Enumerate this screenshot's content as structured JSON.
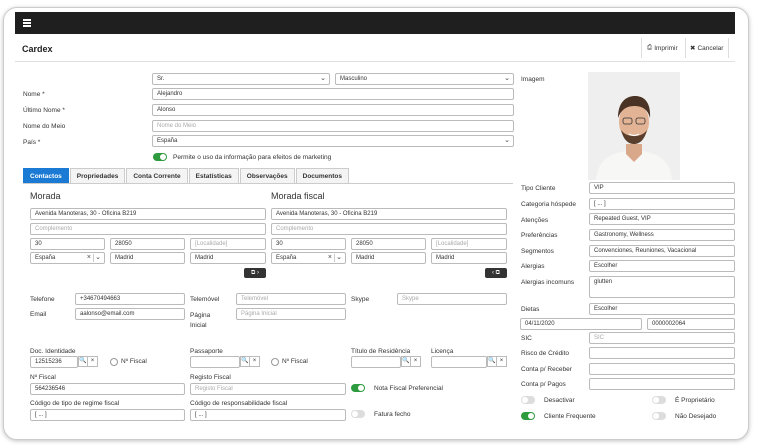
{
  "window": {
    "title": "Cardex",
    "print_label": "Imprimir",
    "cancel_label": "Cancelar"
  },
  "person": {
    "salutation": "Sr.",
    "gender": "Masculino",
    "name_label": "Nome *",
    "name": "Alejandro",
    "last_name_label": "Último Nome *",
    "last_name": "Alonso",
    "middle_name_label": "Nome do Meio",
    "middle_name_placeholder": "Nome do Meio",
    "country_label": "País *",
    "country": "España",
    "marketing_consent": "Permite o uso da informação para efeitos de marketing"
  },
  "tabs": [
    "Contactos",
    "Propriedades",
    "Conta Corrente",
    "Estatísticas",
    "Observações",
    "Documentos"
  ],
  "address": {
    "title": "Morada",
    "fiscal_title": "Morada fiscal",
    "street": "Avenida Manoteras, 30 - Oficina B219",
    "complement_placeholder": "Complemento",
    "number": "30",
    "postal": "28050",
    "locality_placeholder": "[Localidade]",
    "country": "España",
    "city": "Madrid",
    "region": "Madrid"
  },
  "contacts": {
    "phone_label": "Telefone",
    "phone": "+34670494663",
    "mobile_label": "Telemóvel",
    "mobile_placeholder": "Telemóvel",
    "skype_label": "Skype",
    "skype_placeholder": "Skype",
    "email_label": "Email",
    "email": "aalonso@email.com",
    "homepage_label": "Página Inicial",
    "homepage_label_1": "Página",
    "homepage_label_2": "Inicial",
    "homepage_placeholder": "Página Inicial"
  },
  "docs": {
    "id_doc_label": "Doc. Identidade",
    "id_doc": "12515236",
    "nfiscal_check": "Nº Fiscal",
    "passport_label": "Passaporte",
    "passport_nfiscal": "Nº Fiscal",
    "residence_label": "Título de Residência",
    "license_label": "Licença",
    "nfiscal_label": "Nº Fiscal",
    "nfiscal": "564236546",
    "fiscal_reg_label": "Registo Fiscal",
    "fiscal_reg_placeholder": "Registo Fiscal",
    "preferred_invoice": "Nota Fiscal Preferencial",
    "regime_label": "Código de tipo de regime fiscal",
    "regime": "[ ... ]",
    "responsibility_label": "Código de responsabilidade fiscal",
    "responsibility": "[ ... ]",
    "closing_invoice": "Fatura fecho"
  },
  "side": {
    "image_label": "Imagem",
    "client_type_label": "Tipo Cliente",
    "client_type": "VIP",
    "guest_category_label": "Categoria hóspede",
    "guest_category": "[ ... ]",
    "attentions_label": "Atenções",
    "attentions": "Repeated Guest, VIP",
    "preferences_label": "Preferências",
    "preferences": "Gastronomy, Wellness",
    "segments_label": "Segmentos",
    "segments": "Convenciones, Reuniones, Vacacional",
    "allergies_label": "Alergias",
    "allergies": "Escolher",
    "uncommon_allergies_label": "Alergias incomuns",
    "uncommon_allergies": "glutten",
    "diets_label": "Dietas",
    "diets": "Escolher",
    "date": "04/11/2020",
    "code": "0000002064",
    "sic_label": "SIC",
    "sic_placeholder": "SIC",
    "credit_risk_label": "Risco de Crédito",
    "receivable_label": "Conta p/ Receber",
    "payable_label": "Conta p/ Pagos",
    "deactivate_label": "Desactivar",
    "owner_label": "É Proprietário",
    "frequent_label": "Cliente Frequente",
    "unwanted_label": "Não Desejado"
  },
  "colors": {
    "accent": "#1a7ad4",
    "toggle_on": "#2e9b3e",
    "topbar": "#1f1f1f"
  }
}
